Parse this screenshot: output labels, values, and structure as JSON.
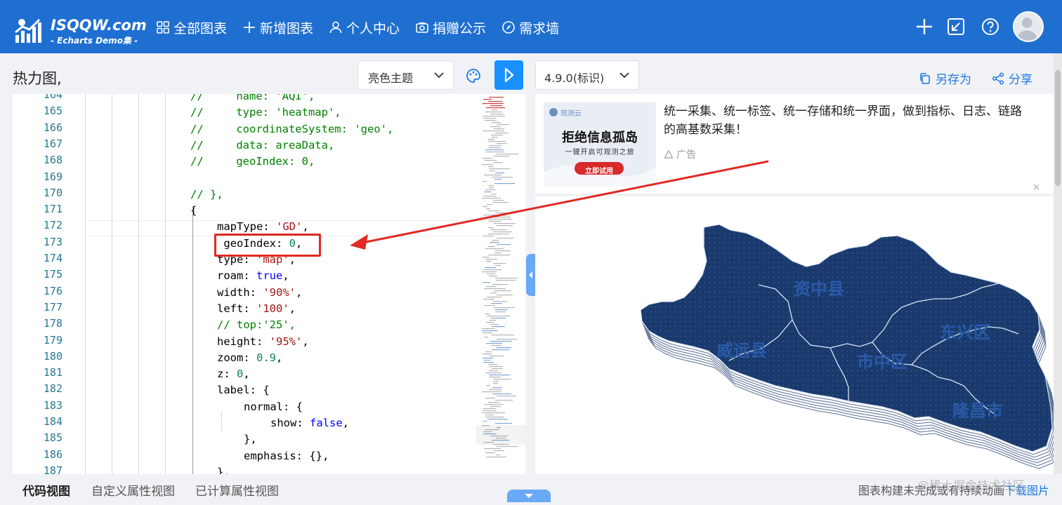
{
  "brand": {
    "title": "ISQQW.com",
    "subtitle": "- Echarts Demo集 -"
  },
  "nav": [
    {
      "label": "全部图表",
      "icon": "grid-icon"
    },
    {
      "label": "新增图表",
      "icon": "plus-icon"
    },
    {
      "label": "个人中心",
      "icon": "user-icon"
    },
    {
      "label": "捐赠公示",
      "icon": "camera-icon"
    },
    {
      "label": "需求墙",
      "icon": "compass-icon"
    }
  ],
  "page": {
    "title": "热力图,"
  },
  "toolbar": {
    "theme": "亮色主题",
    "version": "4.9.0(标识)",
    "save_as": "另存为",
    "share": "分享"
  },
  "editor": {
    "line_numbers": [
      "164",
      "165",
      "166",
      "167",
      "168",
      "169",
      "170",
      "171",
      "172",
      "173",
      "174",
      "175",
      "176",
      "177",
      "178",
      "179",
      "180",
      "181",
      "182",
      "183",
      "184",
      "185",
      "186",
      "187"
    ],
    "lines": [
      {
        "indent": 4,
        "tokens": [
          {
            "t": "//     name: 'AQI',",
            "c": "com"
          }
        ]
      },
      {
        "indent": 4,
        "tokens": [
          {
            "t": "//     type: 'heatmap',",
            "c": "com"
          }
        ]
      },
      {
        "indent": 4,
        "tokens": [
          {
            "t": "//     coordinateSystem: 'geo',",
            "c": "com"
          }
        ]
      },
      {
        "indent": 4,
        "tokens": [
          {
            "t": "//     data: areaData,",
            "c": "com"
          }
        ]
      },
      {
        "indent": 4,
        "tokens": [
          {
            "t": "//     geoIndex: 0,",
            "c": "com"
          }
        ]
      },
      {
        "indent": 0,
        "tokens": []
      },
      {
        "indent": 4,
        "tokens": [
          {
            "t": "// },",
            "c": "com"
          }
        ]
      },
      {
        "indent": 4,
        "tokens": [
          {
            "t": "{",
            "c": ""
          }
        ]
      },
      {
        "indent": 5,
        "tokens": [
          {
            "t": "mapType: ",
            "c": ""
          },
          {
            "t": "'GD'",
            "c": "str"
          },
          {
            "t": ",",
            "c": ""
          }
        ]
      },
      {
        "indent": 5,
        "tokens": [
          {
            "t": " geoIndex: ",
            "c": ""
          },
          {
            "t": "0",
            "c": "num"
          },
          {
            "t": ",",
            "c": ""
          }
        ]
      },
      {
        "indent": 5,
        "tokens": [
          {
            "t": "type: ",
            "c": ""
          },
          {
            "t": "'map'",
            "c": "str"
          },
          {
            "t": ",",
            "c": ""
          }
        ]
      },
      {
        "indent": 5,
        "tokens": [
          {
            "t": "roam: ",
            "c": ""
          },
          {
            "t": "true",
            "c": "kw"
          },
          {
            "t": ",",
            "c": ""
          }
        ]
      },
      {
        "indent": 5,
        "tokens": [
          {
            "t": "width: ",
            "c": ""
          },
          {
            "t": "'90%'",
            "c": "str"
          },
          {
            "t": ",",
            "c": ""
          }
        ]
      },
      {
        "indent": 5,
        "tokens": [
          {
            "t": "left: ",
            "c": ""
          },
          {
            "t": "'100'",
            "c": "str"
          },
          {
            "t": ",",
            "c": ""
          }
        ]
      },
      {
        "indent": 5,
        "tokens": [
          {
            "t": "// top:'25',",
            "c": "com"
          }
        ]
      },
      {
        "indent": 5,
        "tokens": [
          {
            "t": "height: ",
            "c": ""
          },
          {
            "t": "'95%'",
            "c": "str"
          },
          {
            "t": ",",
            "c": ""
          }
        ]
      },
      {
        "indent": 5,
        "tokens": [
          {
            "t": "zoom: ",
            "c": ""
          },
          {
            "t": "0.9",
            "c": "num"
          },
          {
            "t": ",",
            "c": ""
          }
        ]
      },
      {
        "indent": 5,
        "tokens": [
          {
            "t": "z: ",
            "c": ""
          },
          {
            "t": "0",
            "c": "num"
          },
          {
            "t": ",",
            "c": ""
          }
        ]
      },
      {
        "indent": 5,
        "tokens": [
          {
            "t": "label: {",
            "c": ""
          }
        ]
      },
      {
        "indent": 6,
        "tokens": [
          {
            "t": "normal: {",
            "c": ""
          }
        ]
      },
      {
        "indent": 7,
        "tokens": [
          {
            "t": "show: ",
            "c": ""
          },
          {
            "t": "false",
            "c": "kw"
          },
          {
            "t": ",",
            "c": ""
          }
        ]
      },
      {
        "indent": 6,
        "tokens": [
          {
            "t": "},",
            "c": ""
          }
        ]
      },
      {
        "indent": 6,
        "tokens": [
          {
            "t": "emphasis: {},",
            "c": ""
          }
        ]
      },
      {
        "indent": 5,
        "tokens": [
          {
            "t": "},",
            "c": ""
          }
        ]
      }
    ]
  },
  "ad": {
    "banner_brand": "观测云",
    "banner_title": "拒绝信息孤岛",
    "banner_sub": "一键开启可观测之旅",
    "banner_cta": "立即试用",
    "text": "统一采集、统一标签、统一存储和统一界面，做到指标、日志、链路的高基数采集！",
    "label": "广告",
    "close": "×"
  },
  "map": {
    "regions": [
      "资中县",
      "东兴区",
      "威远县",
      "市中区",
      "隆昌市"
    ],
    "fill_color": "#1a3a6e",
    "border_color": "#d9e4f2",
    "label_color": "#2a5aa8"
  },
  "bottom": {
    "tabs": [
      "代码视图",
      "自定义属性视图",
      "已计算属性视图"
    ],
    "status": "图表构建未完成或有持续动画",
    "download": "下载图片",
    "watermark": "@稀土掘金技术社区"
  },
  "colors": {
    "primary": "#1f6fd1",
    "accent": "#1890ff",
    "annotation": "#e02a23"
  }
}
